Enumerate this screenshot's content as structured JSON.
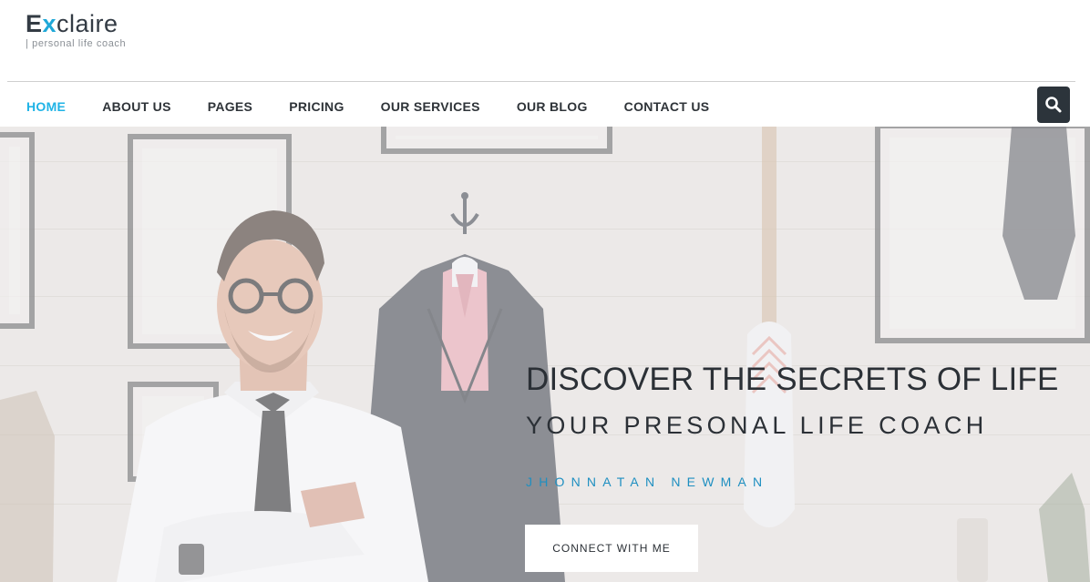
{
  "brand": {
    "name_prefix": "E",
    "name_accent": "x",
    "name_rest": "claire",
    "tagline": "| personal life coach",
    "accent_color": "#1fa8d8"
  },
  "nav": {
    "items": [
      {
        "label": "HOME",
        "active": true
      },
      {
        "label": "ABOUT US",
        "active": false
      },
      {
        "label": "PAGES",
        "active": false
      },
      {
        "label": "PRICING",
        "active": false
      },
      {
        "label": "OUR SERVICES",
        "active": false
      },
      {
        "label": "OUR BLOG",
        "active": false
      },
      {
        "label": "CONTACT US",
        "active": false
      }
    ],
    "active_color": "#1fb3e6",
    "search_icon": "search-icon"
  },
  "hero": {
    "headline": "DISCOVER THE SECRETS OF LIFE",
    "subheadline": "YOUR PRESONAL LIFE COACH",
    "name": "JHONNATAN NEWMAN",
    "cta_label": "CONNECT WITH ME",
    "name_color": "#1e8fc1"
  }
}
